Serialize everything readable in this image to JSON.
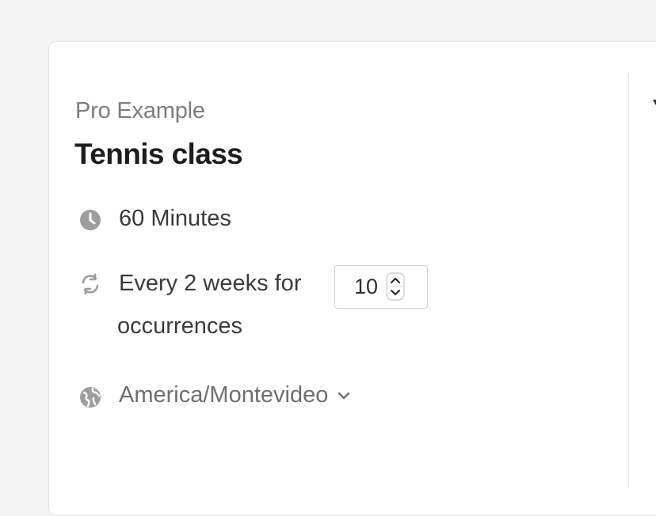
{
  "event": {
    "owner": "Pro Example",
    "title": "Tennis class"
  },
  "details": {
    "duration": "60 Minutes",
    "recurrence_prefix": "Every 2 weeks for",
    "occurrences_value": "10",
    "occurrences_suffix": "occurrences",
    "timezone": "America/Montevideo"
  },
  "icons": {
    "duration": "clock-icon",
    "recurrence": "refresh-icon",
    "timezone": "globe-icon",
    "timezone_toggle": "chevron-down-icon"
  },
  "colors": {
    "background": "#f3f3f3",
    "card": "#ffffff",
    "icon": "#9e9e9e",
    "title": "#1d1d1d",
    "text": "#3b3b3b",
    "muted": "#7d7d7d"
  }
}
